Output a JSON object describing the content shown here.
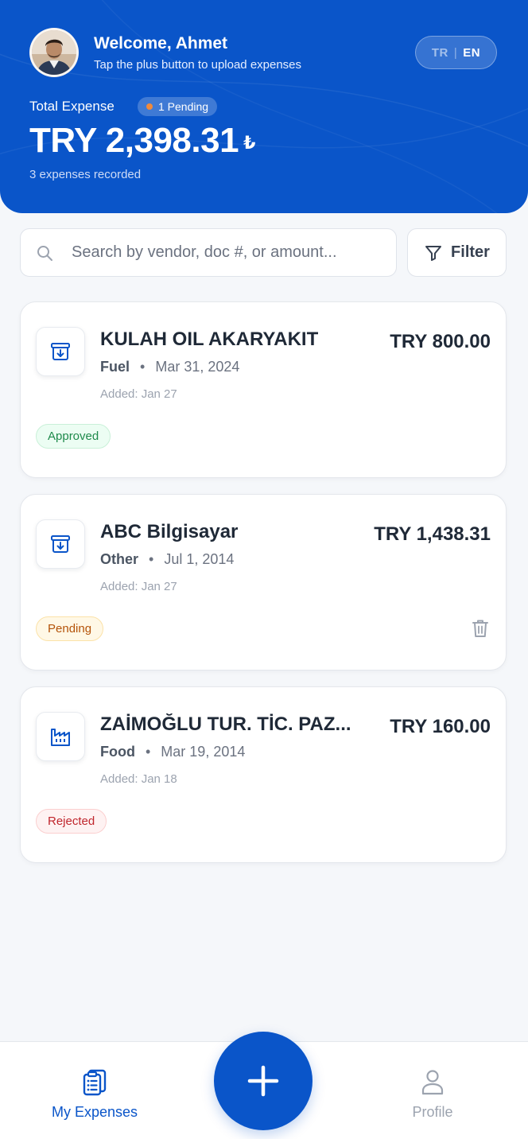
{
  "header": {
    "welcome": "Welcome, Ahmet",
    "subtitle": "Tap the plus button to upload expenses",
    "language": {
      "tr": "TR",
      "separator": "|",
      "en": "EN",
      "active": "EN"
    },
    "total_label": "Total Expense",
    "pending_badge": "1 Pending",
    "total_amount": "TRY 2,398.31",
    "currency_symbol": "₺",
    "expense_count": "3 expenses recorded"
  },
  "search": {
    "placeholder": "Search by vendor, doc #, or amount...",
    "value": ""
  },
  "filter": {
    "label": "Filter"
  },
  "expenses": [
    {
      "vendor": "KULAH OIL AKARYAKIT",
      "amount": "TRY 800.00",
      "category": "Fuel",
      "separator": "•",
      "date": "Mar 31, 2024",
      "added": "Added: Jan 27",
      "status": "Approved",
      "icon": "archive-download-icon"
    },
    {
      "vendor": "ABC Bilgisayar",
      "amount": "TRY 1,438.31",
      "category": "Other",
      "separator": "•",
      "date": "Jul 1, 2014",
      "added": "Added: Jan 27",
      "status": "Pending",
      "icon": "archive-download-icon"
    },
    {
      "vendor": "ZAİMOĞLU TUR. TİC. PAZ...",
      "amount": "TRY 160.00",
      "category": "Food",
      "separator": "•",
      "date": "Mar 19, 2014",
      "added": "Added: Jan 18",
      "status": "Rejected",
      "icon": "factory-icon"
    }
  ],
  "nav": {
    "expenses_label": "My Expenses",
    "profile_label": "Profile",
    "active": "My Expenses"
  },
  "colors": {
    "primary": "#0a55c9",
    "approved": "#1f8a4c",
    "pending": "#b45309",
    "rejected": "#c0262d"
  }
}
